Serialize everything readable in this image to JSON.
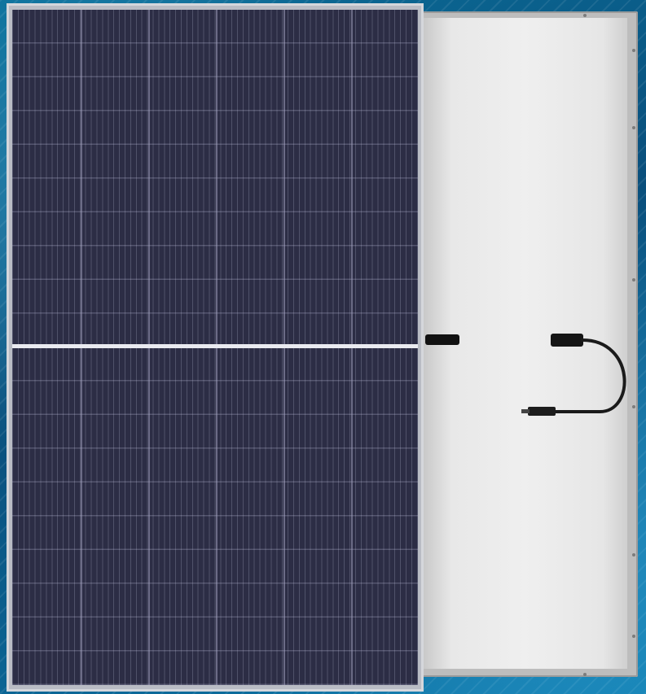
{
  "scene": {
    "subject": "solar-panel-front-and-back",
    "colors": {
      "background": "#0a5a86",
      "cell": "#2c2d45",
      "frame": "#c9ccd2",
      "backsheet": "#ececec",
      "junction": "#111111"
    },
    "icons": [
      "junction-box",
      "mc4-connector",
      "cable"
    ]
  }
}
